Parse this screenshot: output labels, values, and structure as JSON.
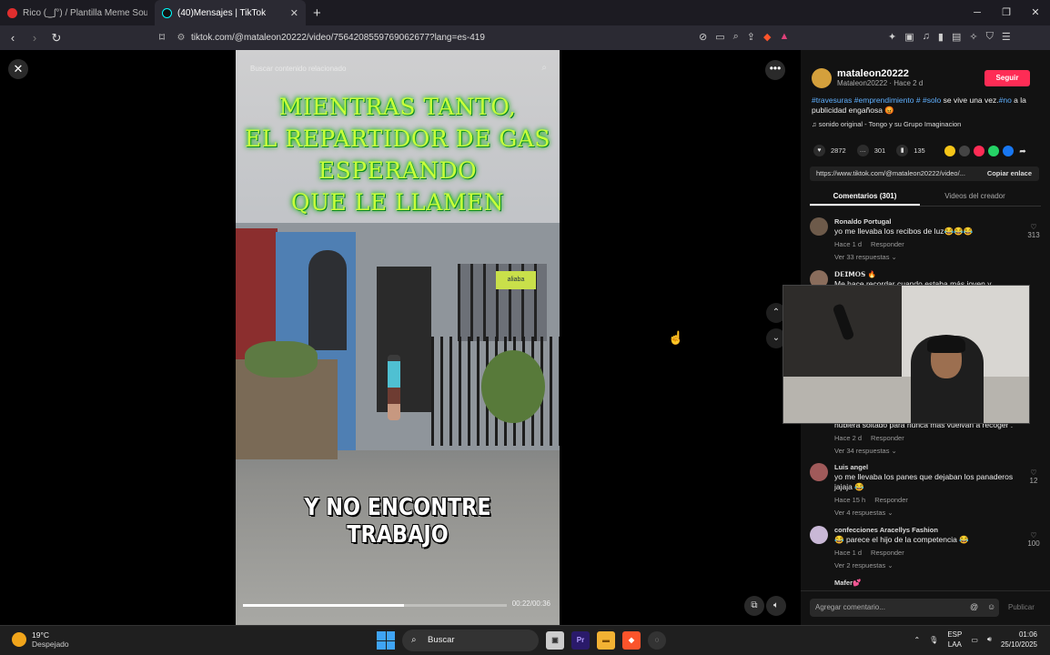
{
  "tabs": [
    {
      "title": "Rico (‿ʃ°) / Plantilla Meme South P",
      "active": false,
      "favicon_color": "#e02e2e"
    },
    {
      "title": "(40)Mensajes | TikTok",
      "active": true,
      "favicon_color": "#111111"
    }
  ],
  "address": {
    "url": "tiktok.com/@mataleon20222/video/7564208559769062677?lang=es-419"
  },
  "video": {
    "search_overlay": "Buscar contenido relacionado",
    "caption_top_lines": [
      "MIENTRAS TANTO,",
      "EL REPARTIDOR DE GAS",
      "ESPERANDO",
      "QUE LE LLAMEN"
    ],
    "caption_bottom": "Y NO ENCONTRE TRABAJO",
    "shop_sign": "aliaba",
    "progress_fraction": 0.61,
    "timecode": "00:22/00:36"
  },
  "post": {
    "username": "mataleon20222",
    "subline": "Mataleon20222 · Hace 2 d",
    "follow_label": "Seguir",
    "desc_tags": [
      "#travesuras",
      "#emprendimiento",
      "#"
    ],
    "desc_tag2": "#solo",
    "desc_mid": " se vive una vez.",
    "desc_tag3": "#no",
    "desc_end": " a la publicidad engañosa 😡",
    "music": "sonido original - Tongo y su Grupo Imaginacion",
    "likes": "2872",
    "comments": "301",
    "saves": "135",
    "link": "https://www.tiktok.com/@mataleon20222/video/...",
    "copy_label": "Copiar enlace"
  },
  "comment_tabs": {
    "comments": "Comentarios (301)",
    "creator": "Videos del creador"
  },
  "comments": [
    {
      "user": "Ronaldo Portugal",
      "text": "yo me llevaba los recibos de luz😂😂😂",
      "time": "Hace 1 d",
      "reply": "Responder",
      "replies": "Ver 33 respuestas ⌄",
      "likes": "313"
    },
    {
      "user": "𝗗𝗘𝗜𝗠𝗢𝗦 🔥",
      "text": "Me hace recordar cuando estaba más joven y entre...",
      "time": "",
      "reply": "",
      "replies": "",
      "likes": ""
    },
    {
      "user": "",
      "text": "hubiera soltado para nunca más vuelvan a recoger .",
      "time": "Hace 2 d",
      "reply": "Responder",
      "replies": "Ver 34 respuestas ⌄",
      "likes": ""
    },
    {
      "user": "Luis angel",
      "text": "yo me llevaba los panes que dejaban los panaderos jajaja 😂",
      "time": "Hace 15 h",
      "reply": "Responder",
      "replies": "Ver 4 respuestas ⌄",
      "likes": "12"
    },
    {
      "user": "confecciones Aracellys Fashion",
      "text": "😂 parece el hijo de la competencia 😂",
      "time": "Hace 1 d",
      "reply": "Responder",
      "replies": "Ver 2 respuestas ⌄",
      "likes": "100"
    },
    {
      "user": "Mafer💕",
      "text": "",
      "time": "",
      "reply": "",
      "replies": "",
      "likes": ""
    }
  ],
  "composer": {
    "placeholder": "Agregar comentario...",
    "publish": "Publicar"
  },
  "taskbar": {
    "temp": "19°C",
    "weather": "Despejado",
    "search": "Buscar",
    "lang_top": "ESP",
    "lang_bottom": "LAA",
    "time": "01:06",
    "date": "25/10/2025"
  }
}
